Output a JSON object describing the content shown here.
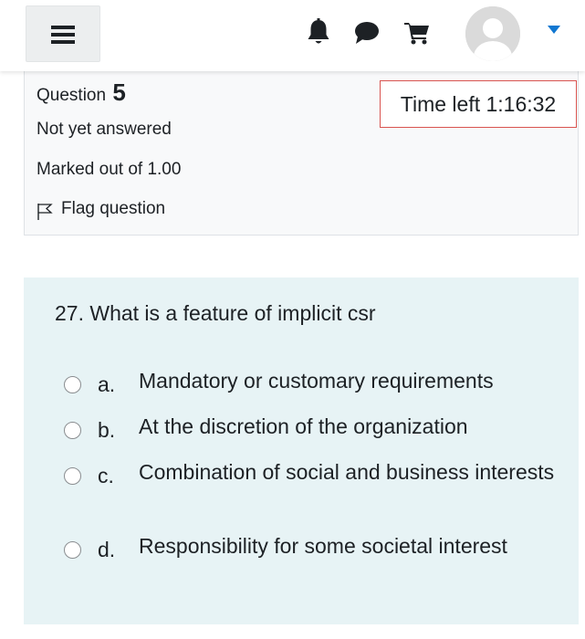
{
  "navbar": {
    "menu_icon": "hamburger-menu-icon",
    "notification_icon": "bell-icon",
    "messages_icon": "chat-bubble-icon",
    "cart_icon": "shopping-cart-icon",
    "avatar_icon": "user-avatar-icon",
    "dropdown_icon": "caret-down-icon",
    "accent_color": "#1177d1"
  },
  "question_info": {
    "label": "Question",
    "number": "5",
    "status": "Not yet answered",
    "marked_out_of": "Marked out of 1.00",
    "flag_label": "Flag question"
  },
  "timer": {
    "text": "Time left 1:16:32",
    "border_color": "#d9534f"
  },
  "question": {
    "text": "27. What is a feature of implicit csr",
    "answers": [
      {
        "letter": "a.",
        "text": "Mandatory or customary requirements",
        "selected": false
      },
      {
        "letter": "b.",
        "text": "At the discretion of the organization",
        "selected": false
      },
      {
        "letter": "c.",
        "text": "Combination of social and business interests",
        "selected": false
      },
      {
        "letter": "d.",
        "text": "Responsibility for some societal interest",
        "selected": false
      }
    ]
  },
  "colors": {
    "question_background": "#e7f3f5",
    "info_background": "#f8f9fa"
  }
}
